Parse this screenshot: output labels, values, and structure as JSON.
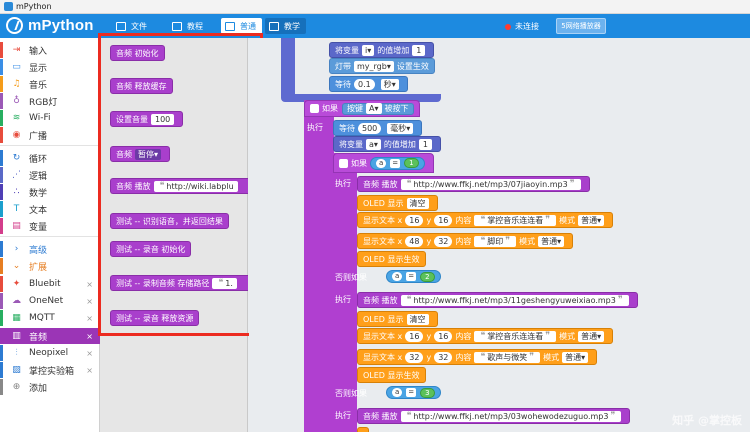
{
  "window": {
    "title": "mPython"
  },
  "header": {
    "logo": "mPython",
    "logo_sub": "",
    "tabs": [
      {
        "label": "文件"
      },
      {
        "label": "教程"
      },
      {
        "label": "普通"
      },
      {
        "label": "教学"
      }
    ],
    "status": "未连接",
    "wifi_button": "5网络播放器"
  },
  "sidebar": {
    "items": [
      {
        "label": "输入",
        "color": "#e84c3d",
        "icon": "⇥"
      },
      {
        "label": "显示",
        "color": "#3a8ee6",
        "icon": "▭"
      },
      {
        "label": "音乐",
        "color": "#f59c1a",
        "icon": "♫"
      },
      {
        "label": "RGB灯",
        "color": "#9b59b6",
        "icon": "♁"
      },
      {
        "label": "Wi-Fi",
        "color": "#27ae60",
        "icon": "≋"
      },
      {
        "label": "广播",
        "color": "#e74c3c",
        "icon": "◉"
      },
      {
        "label": "循环",
        "color": "#2d7bd2",
        "icon": "↻"
      },
      {
        "label": "逻辑",
        "color": "#5a69c7",
        "icon": "⋰"
      },
      {
        "label": "数学",
        "color": "#4f3fb5",
        "icon": "∴"
      },
      {
        "label": "文本",
        "color": "#1b9fcd",
        "icon": "T"
      },
      {
        "label": "变量",
        "color": "#d33d8b",
        "icon": "▤"
      },
      {
        "label": "高级",
        "color": "#2d7bd2",
        "icon": "›"
      },
      {
        "label": "扩展",
        "color": "#e67e22",
        "icon": "⌄"
      },
      {
        "label": "Bluebit",
        "color": "#e74c3c",
        "icon": "✦"
      },
      {
        "label": "OneNet",
        "color": "#9b59b6",
        "icon": "☁"
      },
      {
        "label": "MQTT",
        "color": "#27ae60",
        "icon": "▦"
      },
      {
        "label": "音频",
        "color": "#9b35b6",
        "icon": "▥"
      },
      {
        "label": "Neopixel",
        "color": "#2d7bd2",
        "icon": "⫶"
      },
      {
        "label": "掌控实验箱",
        "color": "#2d7bd2",
        "icon": "▨"
      },
      {
        "label": "添加",
        "color": "#888888",
        "icon": "⊕"
      }
    ],
    "close": "×"
  },
  "flyout": {
    "blocks": [
      {
        "text": "音频 初始化"
      },
      {
        "text": "音频 释放缓存"
      },
      {
        "text": "设置音量",
        "value": "100"
      },
      {
        "text": "音频",
        "option": "暂停"
      },
      {
        "text": "音频 播放",
        "value": "http://wiki.labplu"
      },
      {
        "text": "测试 -- 识别语音，并返回结果"
      },
      {
        "text": "测试 -- 录音 初始化"
      },
      {
        "text": "测试 -- 录制音频 存储路径",
        "value": "1."
      },
      {
        "text": "测试 -- 录音 释放资源"
      }
    ]
  },
  "workspace": {
    "top": [
      {
        "text": "将变量",
        "var": "i",
        "mid": "的值增加",
        "value": "1"
      },
      {
        "text": "灯带",
        "var": "my_rgb",
        "mid": "设置生效"
      },
      {
        "text": "等待",
        "value": "0.1",
        "unit": "秒"
      }
    ],
    "event": {
      "if": "如果",
      "button": "按键",
      "key": "A",
      "pressed": "被按下",
      "do": "执行"
    },
    "wait500": {
      "text": "等待",
      "value": "500",
      "unit": "毫秒"
    },
    "inc": {
      "text": "将变量",
      "var": "a",
      "mid": "的值增加",
      "value": "1"
    },
    "if1": {
      "label": "如果",
      "var": "a",
      "op": "=",
      "num": "1",
      "do": "执行",
      "url": "http://www.ffkj.net/mp3/07jiaoyin.mp3"
    },
    "oled_clear": {
      "text": "OLED 显示",
      "opt": "清空"
    },
    "text1": {
      "text": "显示文本 x",
      "x": "16",
      "y": "16",
      "content": "内容",
      "val": "掌控音乐连连看",
      "mode": "模式",
      "mode_val": "普通"
    },
    "text2": {
      "text": "显示文本 x",
      "x": "48",
      "y": "32",
      "content": "内容",
      "val": "脚印",
      "mode": "模式",
      "mode_val": "普通"
    },
    "oled_show": {
      "text": "OLED 显示生效"
    },
    "elif2": {
      "label": "否则如果",
      "var": "a",
      "op": "=",
      "num": "2",
      "url": "http://www.ffkj.net/mp3/11geshengyuweixiao.mp3"
    },
    "text3": {
      "val": "掌控音乐连连看",
      "x": "16",
      "y": "16"
    },
    "text4": {
      "val": "歌声与微笑",
      "x": "32",
      "y": "32"
    },
    "elif3": {
      "label": "否则如果",
      "var": "a",
      "op": "=",
      "num": "3",
      "url": "http://www.ffkj.net/mp3/03wohewodezuguo.mp3"
    },
    "play": "音频 播放",
    "quote": "❝",
    "quote2": "❞",
    "y_label": "y",
    "watermark": "知乎 @掌控板"
  }
}
